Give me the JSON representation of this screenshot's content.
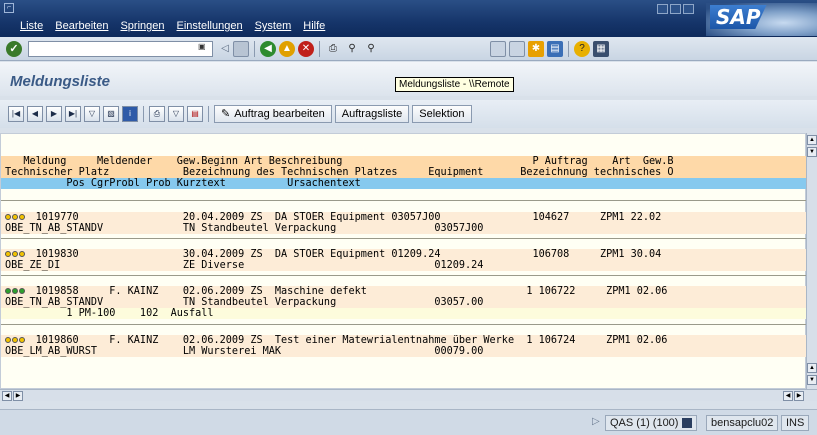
{
  "menu": [
    "Liste",
    "Bearbeiten",
    "Springen",
    "Einstellungen",
    "System",
    "Hilfe"
  ],
  "tooltip": "Meldungsliste - \\\\Remote",
  "page_title": "Meldungsliste",
  "toolbar": {
    "auftrag_bearbeiten": "Auftrag bearbeiten",
    "auftragsliste": "Auftragsliste",
    "selektion": "Selektion"
  },
  "list": {
    "header1": "   Meldung     Meldender    Gew.Beginn Art Beschreibung                               P Auftrag    Art  Gew.B",
    "header2": "Technischer Platz            Bezeichnung des Technischen Platzes     Equipment      Bezeichnung technisches O",
    "header3": "          Pos CgrProbl Prob Kurztext          Ursachentext",
    "records": [
      {
        "led": [
          "#f2c200",
          "#f2c200",
          "#f2c200"
        ],
        "line1": "     1019770                 20.04.2009 ZS  DA STOER Equipment 03057J00               104627     ZPM1 22.02",
        "line2": "OBE_TN_AB_STANDV             TN Standbeutel Verpackung                03057J00",
        "sub": ""
      },
      {
        "led": [
          "#f2c200",
          "#f2c200",
          "#f2c200"
        ],
        "line1": "     1019830                 30.04.2009 ZS  DA STOER Equipment 01209.24               106708     ZPM1 30.04",
        "line2": "OBE_ZE_DI                    ZE Diverse                               01209.24",
        "sub": ""
      },
      {
        "led": [
          "#2ea02e",
          "#2ea02e",
          "#2ea02e"
        ],
        "line1": "     1019858     F. KAINZ    02.06.2009 ZS  Maschine defekt                          1 106722     ZPM1 02.06",
        "line2": "OBE_TN_AB_STANDV             TN Standbeutel Verpackung                03057.00",
        "sub": "          1 PM-100    102  Ausfall"
      },
      {
        "led": [
          "#f2c200",
          "#f2c200",
          "#f2c200"
        ],
        "line1": "     1019860     F. KAINZ    02.06.2009 ZS  Test einer Matewrialentnahme über Werke  1 106724     ZPM1 02.06",
        "line2": "OBE_LM_AB_WURST              LM Wursterei MAK                         00079.00",
        "sub": ""
      }
    ]
  },
  "status": {
    "system": "QAS (1) (100)",
    "server": "bensapclu02",
    "mode": "INS"
  }
}
